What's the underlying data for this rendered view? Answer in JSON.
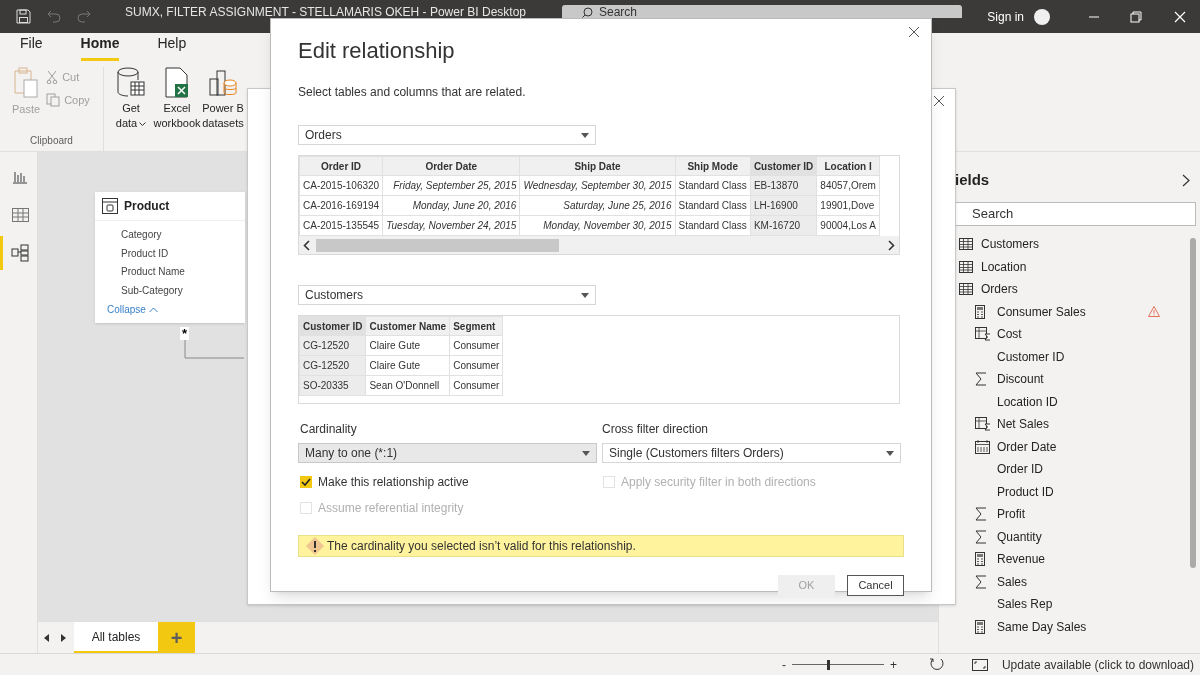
{
  "window": {
    "title": "SUMX, FILTER ASSIGNMENT - STELLAMARIS OKEH - Power BI Desktop",
    "search_placeholder": "Search",
    "sign_in": "Sign in"
  },
  "ribbon": {
    "tabs": [
      {
        "label": "File",
        "selected": false
      },
      {
        "label": "Home",
        "selected": true
      },
      {
        "label": "Help",
        "selected": false
      }
    ],
    "clipboard": {
      "paste": "Paste",
      "cut": "Cut",
      "copy": "Copy",
      "group": "Clipboard",
      "disabled": true
    },
    "data_buttons": [
      {
        "kind": "database",
        "lines": [
          "Get",
          "data"
        ],
        "dropdown": true
      },
      {
        "kind": "excel",
        "lines": [
          "Excel",
          "workbook"
        ],
        "dropdown": false
      },
      {
        "kind": "datasets",
        "lines": [
          "Power B",
          "datasets"
        ],
        "dropdown": false
      }
    ]
  },
  "views": [
    {
      "kind": "report",
      "selected": false
    },
    {
      "kind": "data",
      "selected": false
    },
    {
      "kind": "model",
      "selected": true
    }
  ],
  "canvas": {
    "table_card": {
      "title": "Product",
      "fields": [
        "Category",
        "Product ID",
        "Product Name",
        "Sub-Category"
      ],
      "collapse": "Collapse"
    },
    "cardinality_mark": "*"
  },
  "page_tabs": [
    {
      "label": "All tables",
      "selected": true
    }
  ],
  "add_tab": "+",
  "status_bar": {
    "zoom_minus": "-",
    "zoom_plus": "+",
    "level": 0.4,
    "update": "Update available (click to download)"
  },
  "fields_pane": {
    "title": "ields",
    "search_placeholder": "Search",
    "items": [
      {
        "name": "Customers",
        "kind": "table"
      },
      {
        "name": "Location",
        "kind": "table"
      },
      {
        "name": "Orders",
        "kind": "table",
        "children": [
          {
            "name": "Consumer Sales",
            "kind": "measure",
            "warning": true
          },
          {
            "name": "Cost",
            "kind": "calc-column",
            "warning": false
          },
          {
            "name": "Customer ID",
            "kind": "plain",
            "warning": false
          },
          {
            "name": "Discount",
            "kind": "sum",
            "warning": false
          },
          {
            "name": "Location ID",
            "kind": "plain",
            "warning": false
          },
          {
            "name": "Net Sales",
            "kind": "calc-column",
            "warning": false
          },
          {
            "name": "Order Date",
            "kind": "date",
            "warning": false
          },
          {
            "name": "Order ID",
            "kind": "plain",
            "warning": false
          },
          {
            "name": "Product ID",
            "kind": "plain",
            "warning": false
          },
          {
            "name": "Profit",
            "kind": "sum",
            "warning": false
          },
          {
            "name": "Quantity",
            "kind": "sum",
            "warning": false
          },
          {
            "name": "Revenue",
            "kind": "measure",
            "warning": false
          },
          {
            "name": "Sales",
            "kind": "sum",
            "warning": false
          },
          {
            "name": "Sales Rep",
            "kind": "plain",
            "warning": false
          },
          {
            "name": "Same Day Sales",
            "kind": "measure",
            "warning": false
          }
        ]
      }
    ]
  },
  "dialog": {
    "title": "Edit relationship",
    "subtitle": "Select tables and columns that are related.",
    "table_1": {
      "value": "Orders",
      "columns": [
        {
          "label": "Order ID",
          "selected": false,
          "kind": "text"
        },
        {
          "label": "Order Date",
          "selected": false,
          "kind": "date"
        },
        {
          "label": "Ship Date",
          "selected": false,
          "kind": "date"
        },
        {
          "label": "Ship Mode",
          "selected": false,
          "kind": "text"
        },
        {
          "label": "Customer ID",
          "selected": true,
          "kind": "text"
        },
        {
          "label": "Location I",
          "selected": false,
          "kind": "text"
        }
      ],
      "rows": [
        [
          "CA-2015-106320",
          "Friday, September 25, 2015",
          "Wednesday, September 30, 2015",
          "Standard Class",
          "EB-13870",
          "84057,Orem"
        ],
        [
          "CA-2016-169194",
          "Monday, June 20, 2016",
          "Saturday, June 25, 2016",
          "Standard Class",
          "LH-16900",
          "19901,Dove"
        ],
        [
          "CA-2015-135545",
          "Tuesday, November 24, 2015",
          "Monday, November 30, 2015",
          "Standard Class",
          "KM-16720",
          "90004,Los A"
        ]
      ]
    },
    "table_2": {
      "value": "Customers",
      "columns": [
        {
          "label": "Customer ID",
          "selected": true
        },
        {
          "label": "Customer Name",
          "selected": false
        },
        {
          "label": "Segment",
          "selected": false
        }
      ],
      "rows": [
        [
          "CG-12520",
          "Claire Gute",
          "Consumer"
        ],
        [
          "CG-12520",
          "Claire Gute",
          "Consumer"
        ],
        [
          "SO-20335",
          "Sean O'Donnell",
          "Consumer"
        ]
      ]
    },
    "cardinality": {
      "label": "Cardinality",
      "value": "Many to one (*:1)",
      "disabled": true
    },
    "cross_filter": {
      "label": "Cross filter direction",
      "value": "Single (Customers filters Orders)",
      "disabled": false
    },
    "options": [
      {
        "label": "Make this relationship active",
        "checked": true,
        "disabled": false
      },
      {
        "label": "Apply security filter in both directions",
        "checked": false,
        "disabled": true
      },
      {
        "label": "Assume referential integrity",
        "checked": false,
        "disabled": true
      }
    ],
    "warning": "The cardinality you selected isn’t valid for this relationship.",
    "buttons": [
      {
        "label": "OK",
        "disabled": true
      },
      {
        "label": "Cancel",
        "disabled": false
      }
    ]
  }
}
